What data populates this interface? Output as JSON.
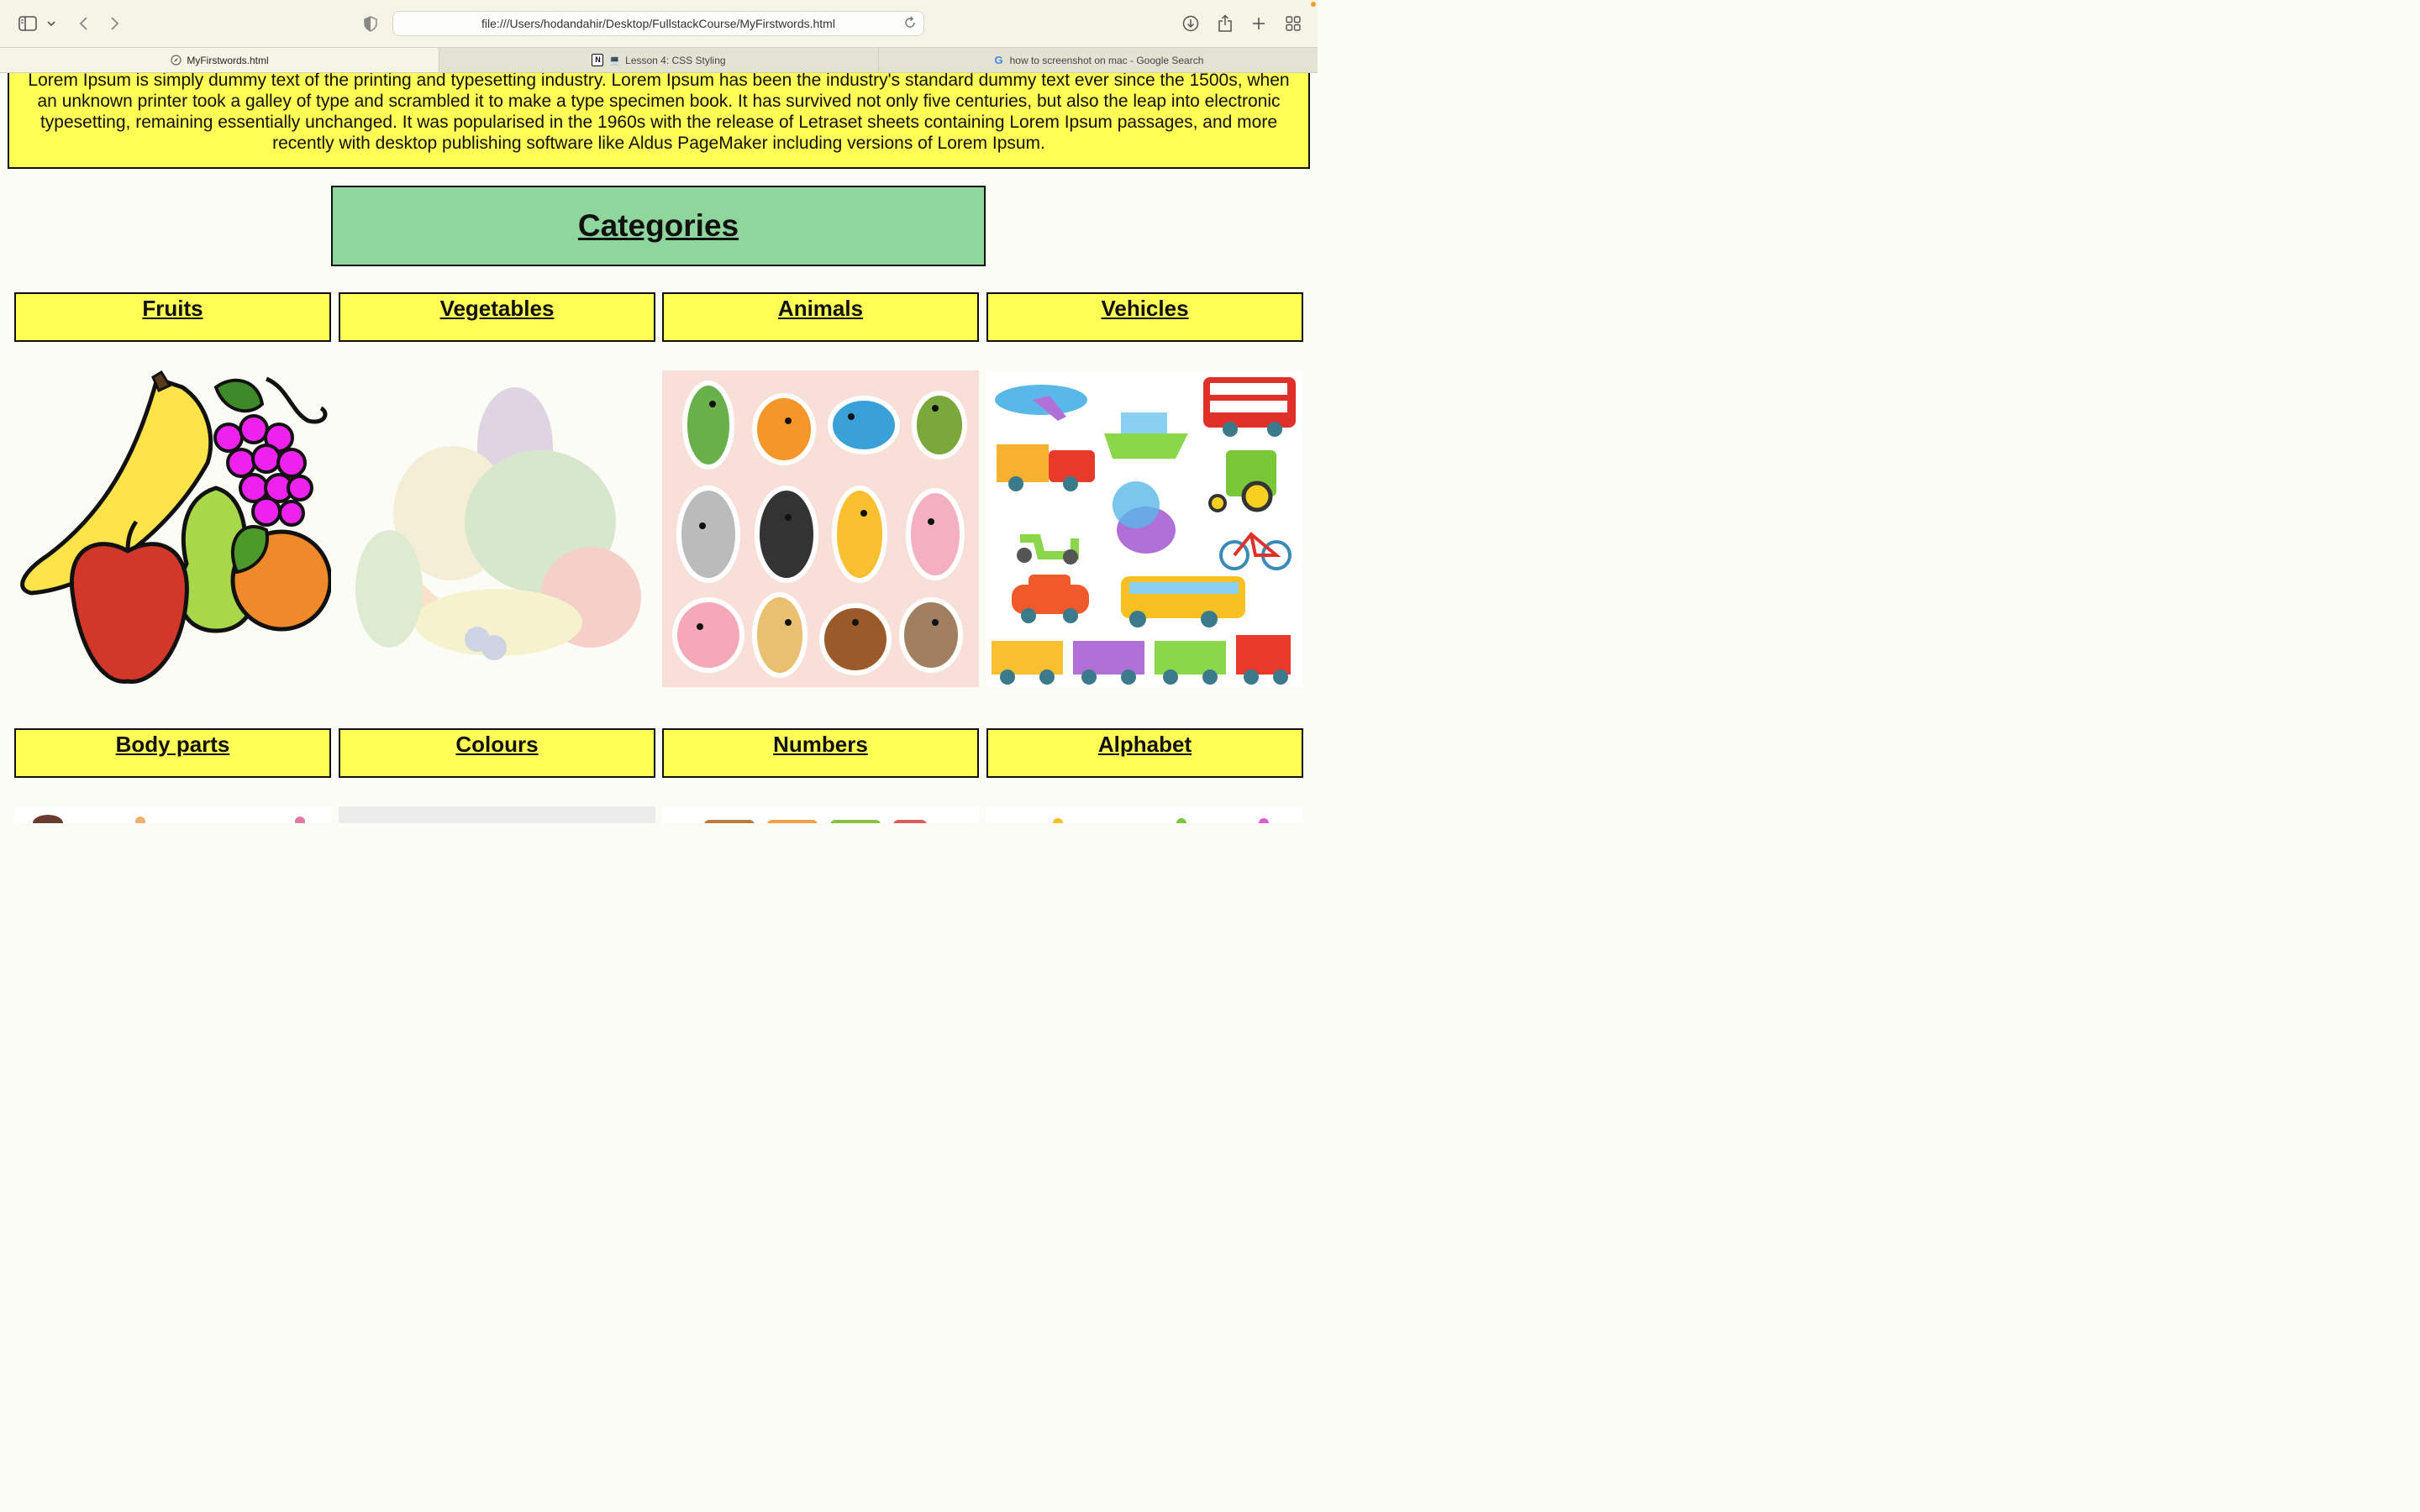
{
  "browser": {
    "url": "file:///Users/hodandahir/Desktop/FullstackCourse/MyFirstwords.html",
    "tabs": [
      {
        "label": "MyFirstwords.html",
        "icon": "compass-icon",
        "active": true
      },
      {
        "label": "Lesson 4: CSS Styling",
        "icon": "notion-icon",
        "active": false
      },
      {
        "label": "how to screenshot on mac - Google Search",
        "icon": "google-icon",
        "active": false
      }
    ],
    "notion_glyph": "N",
    "google_glyph": "G",
    "laptop_emoji": "💻"
  },
  "page": {
    "intro_text": "Lorem Ipsum is simply dummy text of the printing and typesetting industry. Lorem Ipsum has been the industry's standard dummy text ever since the 1500s, when an unknown printer took a galley of type and scrambled it to make a type specimen book. It has survived not only five centuries, but also the leap into electronic typesetting, remaining essentially unchanged. It was popularised in the 1960s with the release of Letraset sheets containing Lorem Ipsum passages, and more recently with desktop publishing software like Aldus PageMaker including versions of Lorem Ipsum.",
    "categories_heading": "Categories",
    "row1": [
      "Fruits",
      "Vegetables",
      "Animals",
      "Vehicles"
    ],
    "row2": [
      "Body parts",
      "Colours",
      "Numbers",
      "Alphabet"
    ]
  },
  "colors": {
    "yellow_box": "#ffff55",
    "green_heading": "#8fd69c",
    "page_bg": "#fcfcf7"
  }
}
